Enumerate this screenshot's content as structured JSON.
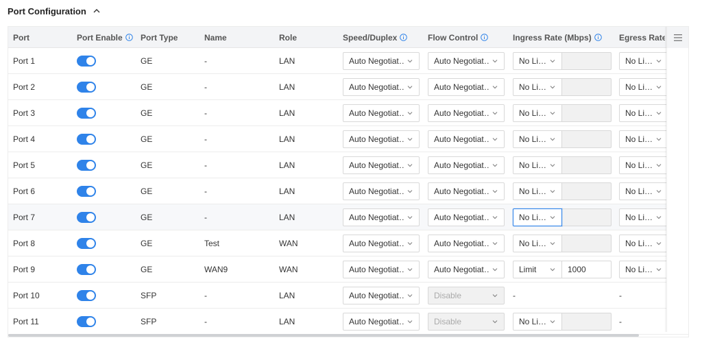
{
  "section": {
    "title": "Port Configuration"
  },
  "columns": {
    "port": "Port",
    "enable": "Port Enable",
    "type": "Port Type",
    "name": "Name",
    "role": "Role",
    "speed": "Speed/Duplex",
    "flow": "Flow Control",
    "ingress": "Ingress Rate (Mbps)",
    "egress": "Egress Rate ("
  },
  "colors": {
    "accent": "#2f83e9",
    "header_bg": "#f3f4f6"
  },
  "rows": [
    {
      "port": "Port 1",
      "enabled": true,
      "type": "GE",
      "name": "-",
      "role": "LAN",
      "speed": "Auto Negotiat…",
      "flow": "Auto Negotiat…",
      "flow_disabled": false,
      "ingress": "No Li…",
      "ingress_value": "",
      "ingress_input_disabled": true,
      "ingress_dash": false,
      "egress": "No Li…",
      "egress_dash": false
    },
    {
      "port": "Port 2",
      "enabled": true,
      "type": "GE",
      "name": "-",
      "role": "LAN",
      "speed": "Auto Negotiat…",
      "flow": "Auto Negotiat…",
      "flow_disabled": false,
      "ingress": "No Li…",
      "ingress_value": "",
      "ingress_input_disabled": true,
      "ingress_dash": false,
      "egress": "No Li…",
      "egress_dash": false
    },
    {
      "port": "Port 3",
      "enabled": true,
      "type": "GE",
      "name": "-",
      "role": "LAN",
      "speed": "Auto Negotiat…",
      "flow": "Auto Negotiat…",
      "flow_disabled": false,
      "ingress": "No Li…",
      "ingress_value": "",
      "ingress_input_disabled": true,
      "ingress_dash": false,
      "egress": "No Li…",
      "egress_dash": false
    },
    {
      "port": "Port 4",
      "enabled": true,
      "type": "GE",
      "name": "-",
      "role": "LAN",
      "speed": "Auto Negotiat…",
      "flow": "Auto Negotiat…",
      "flow_disabled": false,
      "ingress": "No Li…",
      "ingress_value": "",
      "ingress_input_disabled": true,
      "ingress_dash": false,
      "egress": "No Li…",
      "egress_dash": false
    },
    {
      "port": "Port 5",
      "enabled": true,
      "type": "GE",
      "name": "-",
      "role": "LAN",
      "speed": "Auto Negotiat…",
      "flow": "Auto Negotiat…",
      "flow_disabled": false,
      "ingress": "No Li…",
      "ingress_value": "",
      "ingress_input_disabled": true,
      "ingress_dash": false,
      "egress": "No Li…",
      "egress_dash": false
    },
    {
      "port": "Port 6",
      "enabled": true,
      "type": "GE",
      "name": "-",
      "role": "LAN",
      "speed": "Auto Negotiat…",
      "flow": "Auto Negotiat…",
      "flow_disabled": false,
      "ingress": "No Li…",
      "ingress_value": "",
      "ingress_input_disabled": true,
      "ingress_dash": false,
      "egress": "No Li…",
      "egress_dash": false
    },
    {
      "port": "Port 7",
      "enabled": true,
      "type": "GE",
      "name": "-",
      "role": "LAN",
      "speed": "Auto Negotiat…",
      "flow": "Auto Negotiat…",
      "flow_disabled": false,
      "ingress": "No Li…",
      "ingress_value": "",
      "ingress_input_disabled": true,
      "ingress_dash": false,
      "egress": "No Li…",
      "egress_dash": false
    },
    {
      "port": "Port 8",
      "enabled": true,
      "type": "GE",
      "name": "Test",
      "role": "WAN",
      "speed": "Auto Negotiat…",
      "flow": "Auto Negotiat…",
      "flow_disabled": false,
      "ingress": "No Li…",
      "ingress_value": "",
      "ingress_input_disabled": true,
      "ingress_dash": false,
      "egress": "No Li…",
      "egress_dash": false
    },
    {
      "port": "Port 9",
      "enabled": true,
      "type": "GE",
      "name": "WAN9",
      "role": "WAN",
      "speed": "Auto Negotiat…",
      "flow": "Auto Negotiat…",
      "flow_disabled": false,
      "ingress": "Limit",
      "ingress_value": "1000",
      "ingress_input_disabled": false,
      "ingress_dash": false,
      "egress": "No Li…",
      "egress_dash": false
    },
    {
      "port": "Port 10",
      "enabled": true,
      "type": "SFP",
      "name": "-",
      "role": "LAN",
      "speed": "Auto Negotiat…",
      "flow": "Disable",
      "flow_disabled": true,
      "ingress": "-",
      "ingress_value": "",
      "ingress_input_disabled": true,
      "ingress_dash": true,
      "egress": "-",
      "egress_dash": true
    },
    {
      "port": "Port 11",
      "enabled": true,
      "type": "SFP",
      "name": "-",
      "role": "LAN",
      "speed": "Auto Negotiat…",
      "flow": "Disable",
      "flow_disabled": true,
      "ingress": "No Li…",
      "ingress_value": "",
      "ingress_input_disabled": true,
      "ingress_dash": false,
      "egress": "-",
      "egress_dash": true
    }
  ]
}
